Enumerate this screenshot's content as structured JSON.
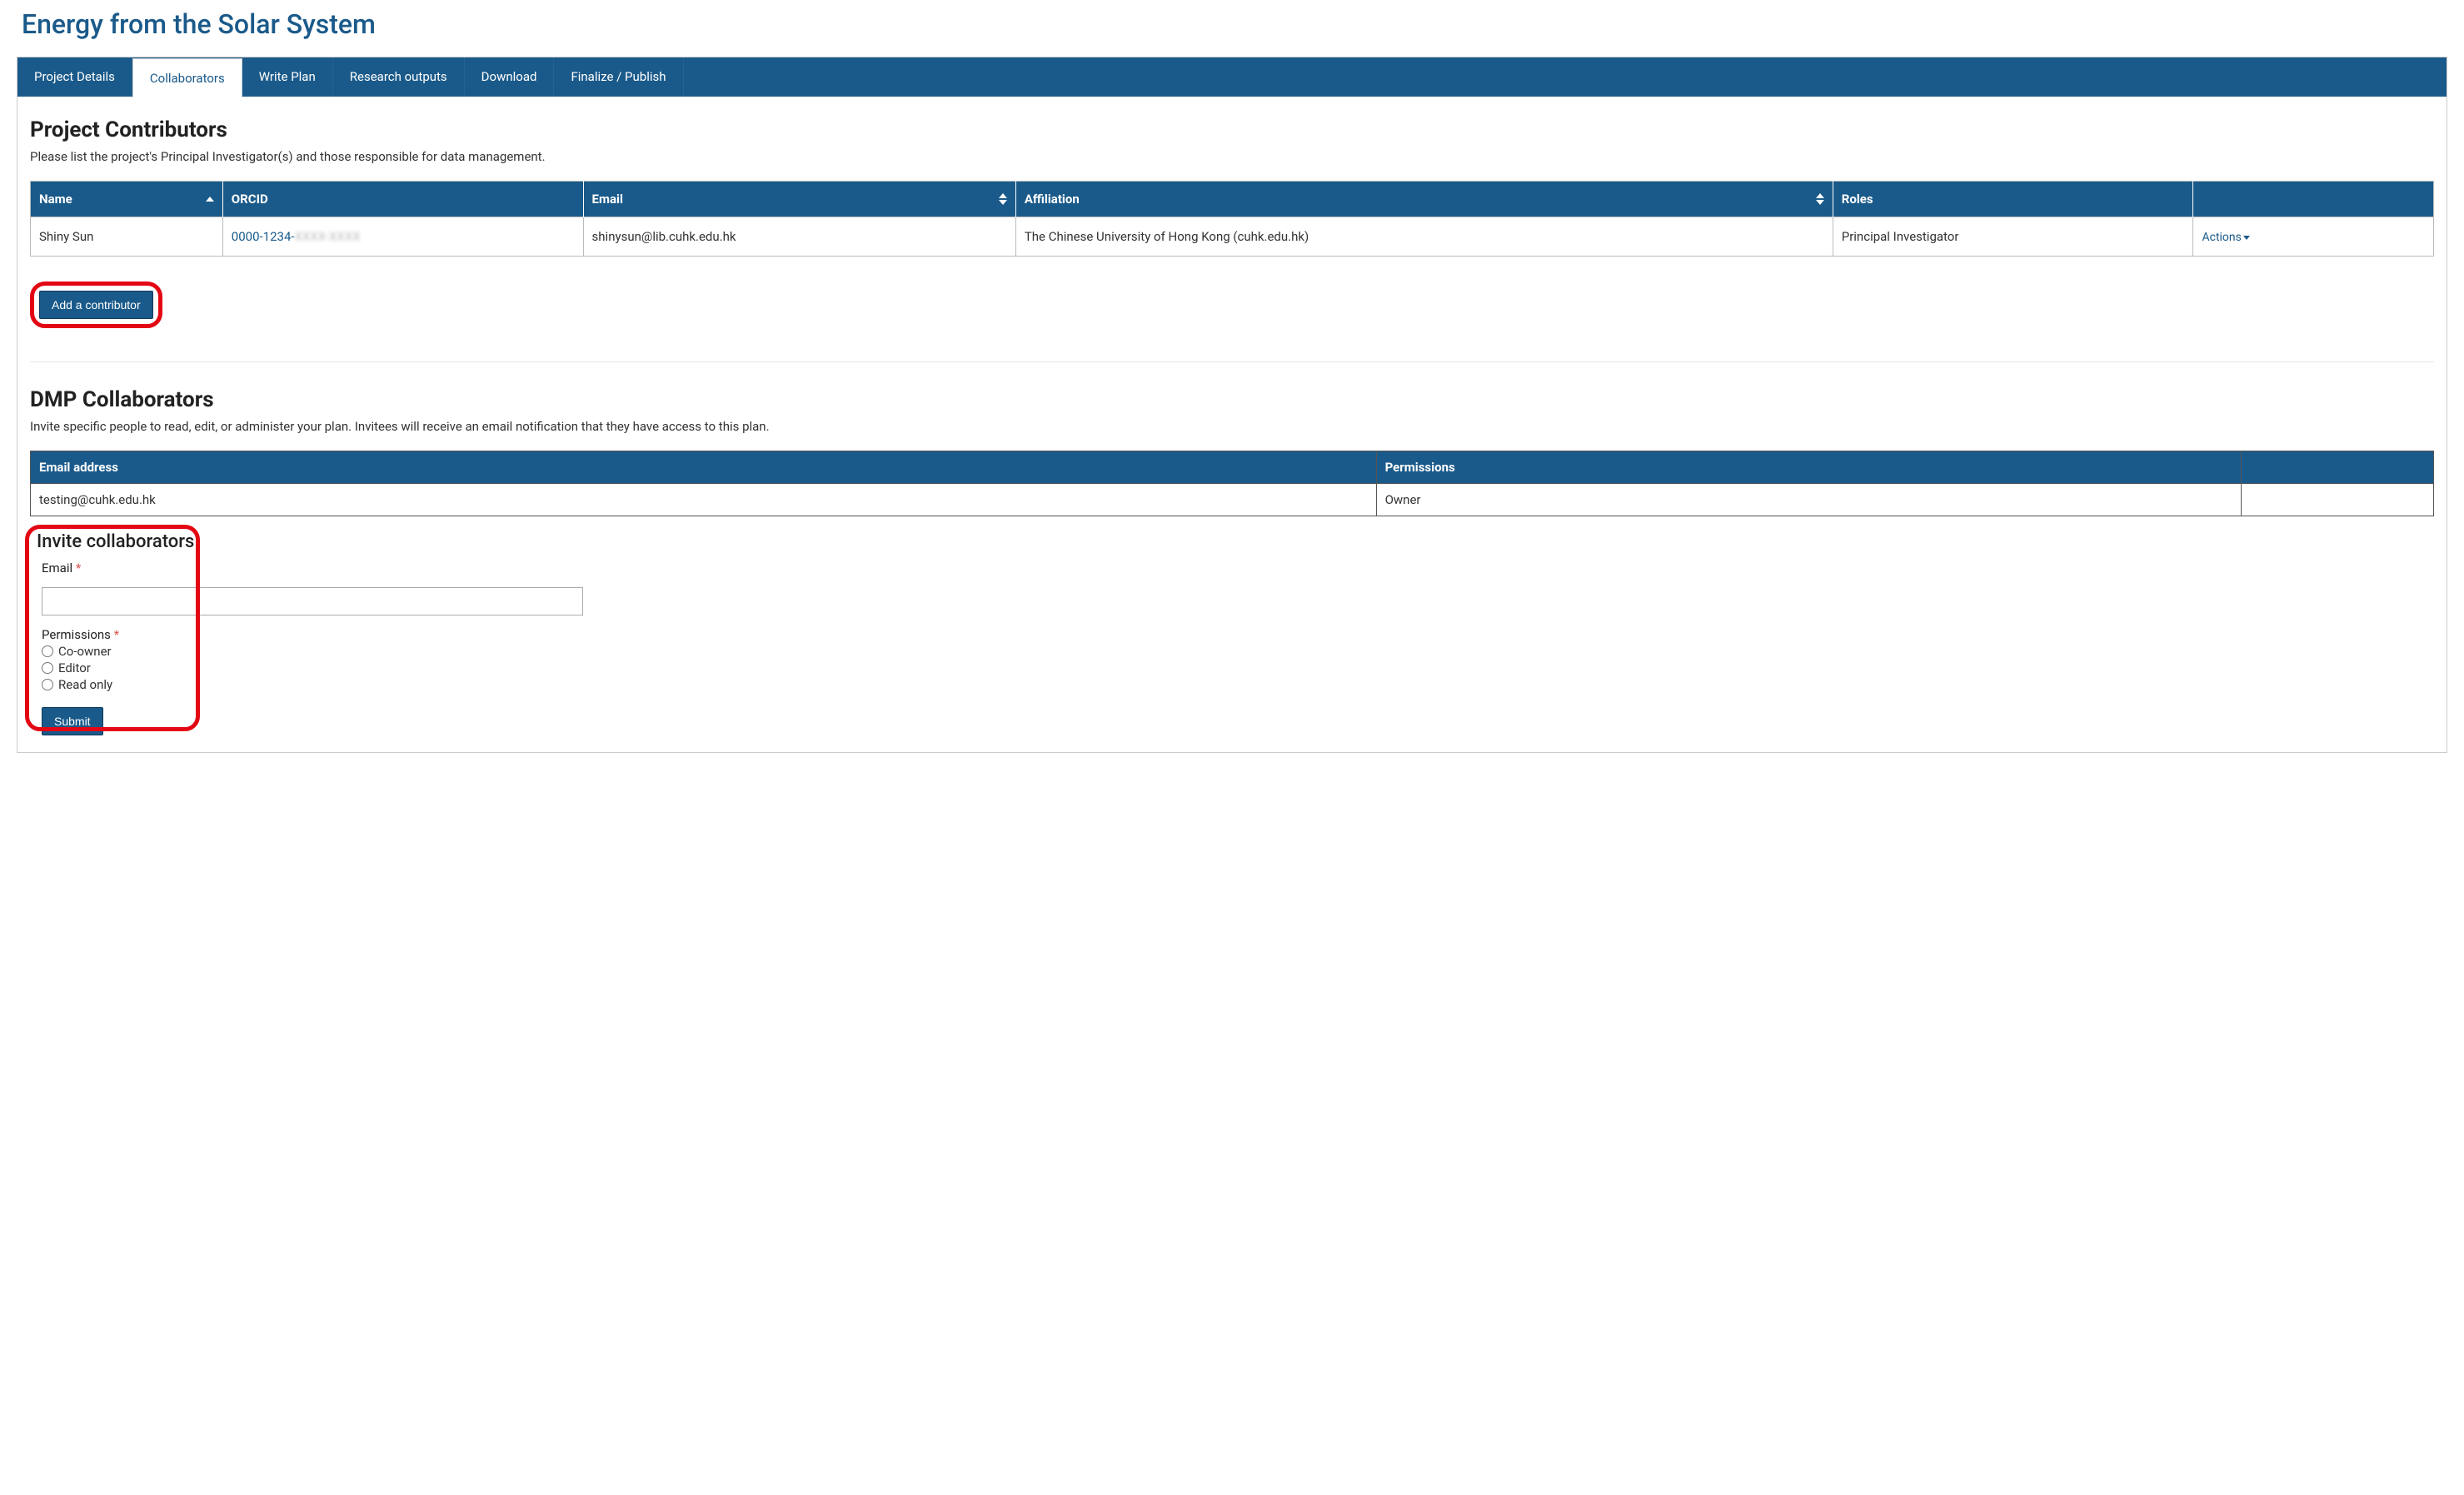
{
  "page": {
    "title": "Energy from the Solar System"
  },
  "tabs": {
    "project_details": "Project Details",
    "collaborators": "Collaborators",
    "write_plan": "Write Plan",
    "research_outputs": "Research outputs",
    "download": "Download",
    "finalize": "Finalize / Publish"
  },
  "contributors": {
    "heading": "Project Contributors",
    "description": "Please list the project's Principal Investigator(s) and those responsible for data management.",
    "columns": {
      "name": "Name",
      "orcid": "ORCID",
      "email": "Email",
      "affiliation": "Affiliation",
      "roles": "Roles"
    },
    "rows": [
      {
        "name": "Shiny Sun",
        "orcid_visible": "0000-1234-",
        "orcid_hidden": "XXXX-XXXX",
        "email": "shinysun@lib.cuhk.edu.hk",
        "affiliation": "The Chinese University of Hong Kong (cuhk.edu.hk)",
        "roles": "Principal Investigator",
        "actions": "Actions"
      }
    ],
    "add_button": "Add a contributor"
  },
  "collaborators": {
    "heading": "DMP Collaborators",
    "description": "Invite specific people to read, edit, or administer your plan. Invitees will receive an email notification that they have access to this plan.",
    "columns": {
      "email": "Email address",
      "permissions": "Permissions"
    },
    "rows": [
      {
        "email": "testing@cuhk.edu.hk",
        "permissions": "Owner"
      }
    ]
  },
  "invite": {
    "heading": "Invite collaborators",
    "email_label": "Email",
    "permissions_label": "Permissions",
    "options": {
      "coowner": "Co-owner",
      "editor": "Editor",
      "readonly": "Read only"
    },
    "submit": "Submit"
  }
}
